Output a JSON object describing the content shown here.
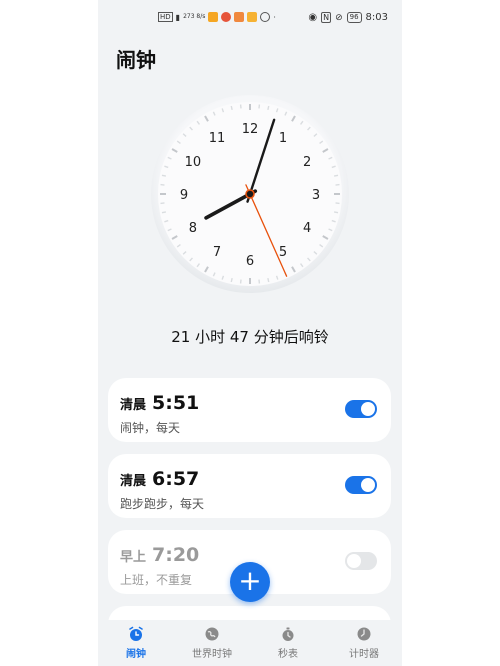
{
  "status_bar": {
    "left_text": "273 8/s",
    "battery": "96",
    "time": "8:03",
    "icons": [
      "hd-icon",
      "signal-icon",
      "app-icons",
      "eye-icon",
      "nfc-icon",
      "mute-icon",
      "battery-icon"
    ]
  },
  "header": {
    "title": "闹钟"
  },
  "clock": {
    "numbers": [
      "12",
      "1",
      "2",
      "3",
      "4",
      "5",
      "6",
      "7",
      "8",
      "9",
      "10",
      "11"
    ],
    "hour_hand_hours": 8.05,
    "minute_hand_minutes": 3,
    "second_hand_seconds": 26,
    "second_hand_color": "#e8510c"
  },
  "countdown": {
    "text": "21 小时 47 分钟后响铃"
  },
  "alarms": [
    {
      "period": "清晨",
      "time": "5:51",
      "sub": "闹钟，每天",
      "enabled": true
    },
    {
      "period": "清晨",
      "time": "6:57",
      "sub": "跑步跑步，每天",
      "enabled": true
    },
    {
      "period": "早上",
      "time": "7:20",
      "sub": "上班，不重复",
      "enabled": false
    }
  ],
  "fab": {
    "label": "+"
  },
  "tabs": [
    {
      "label": "闹钟",
      "icon": "alarm-clock-icon",
      "active": true
    },
    {
      "label": "世界时钟",
      "icon": "globe-icon",
      "active": false
    },
    {
      "label": "秒表",
      "icon": "stopwatch-icon",
      "active": false
    },
    {
      "label": "计时器",
      "icon": "timer-icon",
      "active": false
    }
  ],
  "colors": {
    "accent": "#1a73e8",
    "background": "#f1f3f5"
  }
}
